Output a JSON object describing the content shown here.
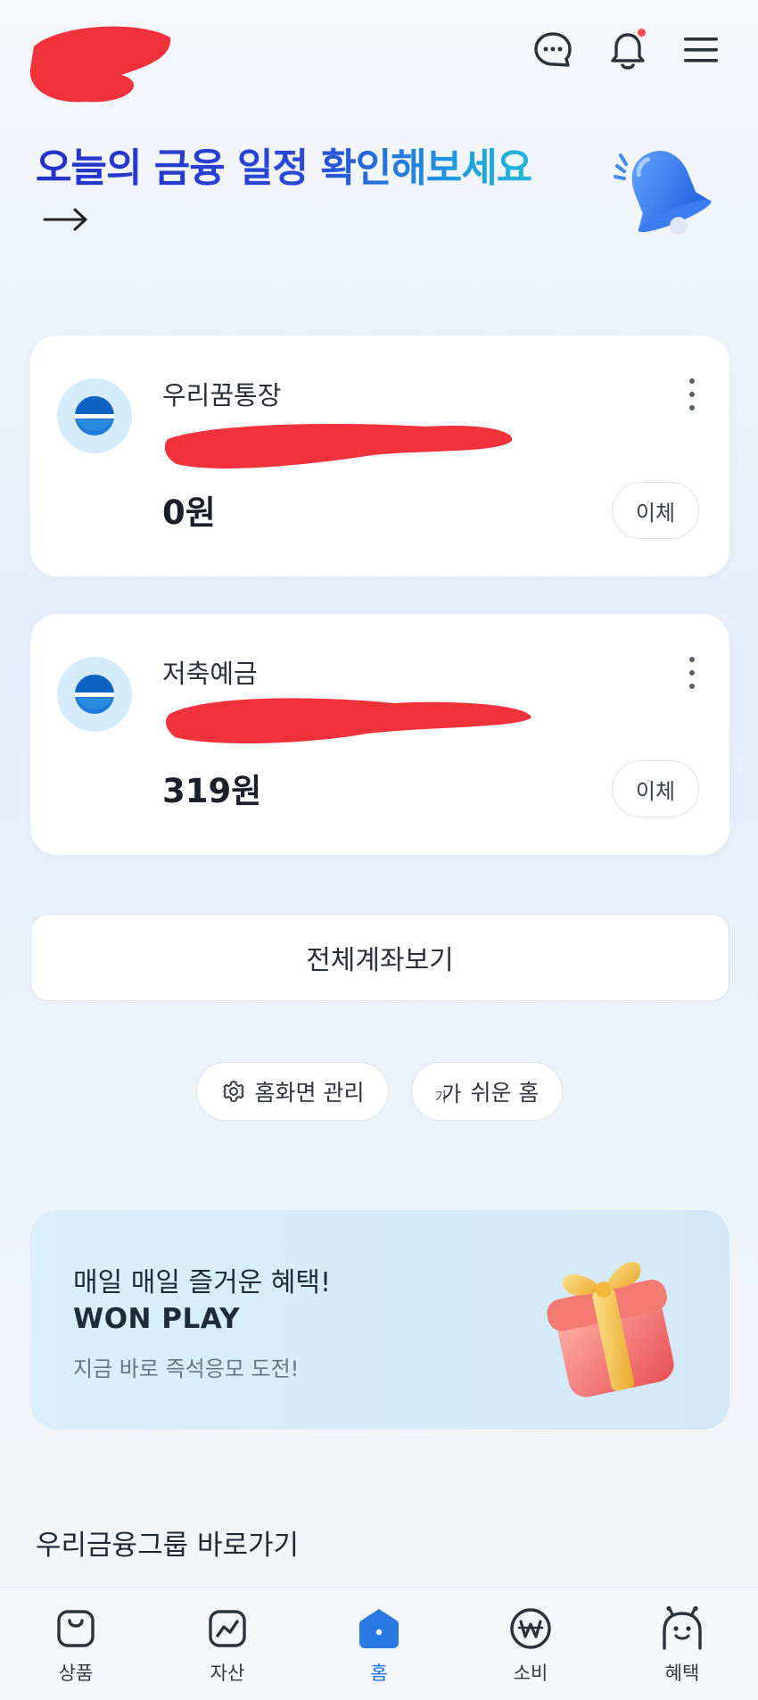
{
  "header": {
    "icons": [
      "chat-bubble-icon",
      "bell-icon",
      "hamburger-menu-icon"
    ],
    "has_notification": true
  },
  "headline": {
    "text": "오늘의 금융 일정 확인해보세요",
    "arrow": "→"
  },
  "accounts": [
    {
      "name": "우리꿈통장",
      "balance": "0원",
      "action": "이체"
    },
    {
      "name": "저축예금",
      "balance": "319원",
      "action": "이체"
    }
  ],
  "view_all_label": "전체계좌보기",
  "home_tools": {
    "manage_label": "홈화면 관리",
    "easy_home_small": "가",
    "easy_home_big": "가",
    "easy_home_label": "쉬운 홈"
  },
  "banner": {
    "line1": "매일 매일 즐거운 혜택!",
    "line2": "WON PLAY",
    "line3": "지금 바로 즉석응모 도전!"
  },
  "section_title": "우리금융그룹 바로가기",
  "bottom_nav": [
    {
      "label": "상품",
      "icon": "shopping-bag-icon"
    },
    {
      "label": "자산",
      "icon": "asset-chart-icon"
    },
    {
      "label": "홈",
      "icon": "home-icon",
      "active": true
    },
    {
      "label": "소비",
      "icon": "won-coin-icon"
    },
    {
      "label": "혜택",
      "icon": "benefit-character-icon"
    }
  ],
  "colors": {
    "accent": "#1f74e6",
    "headline_start": "#2331c9",
    "headline_end": "#22b8d9",
    "redaction": "#f2323a"
  }
}
